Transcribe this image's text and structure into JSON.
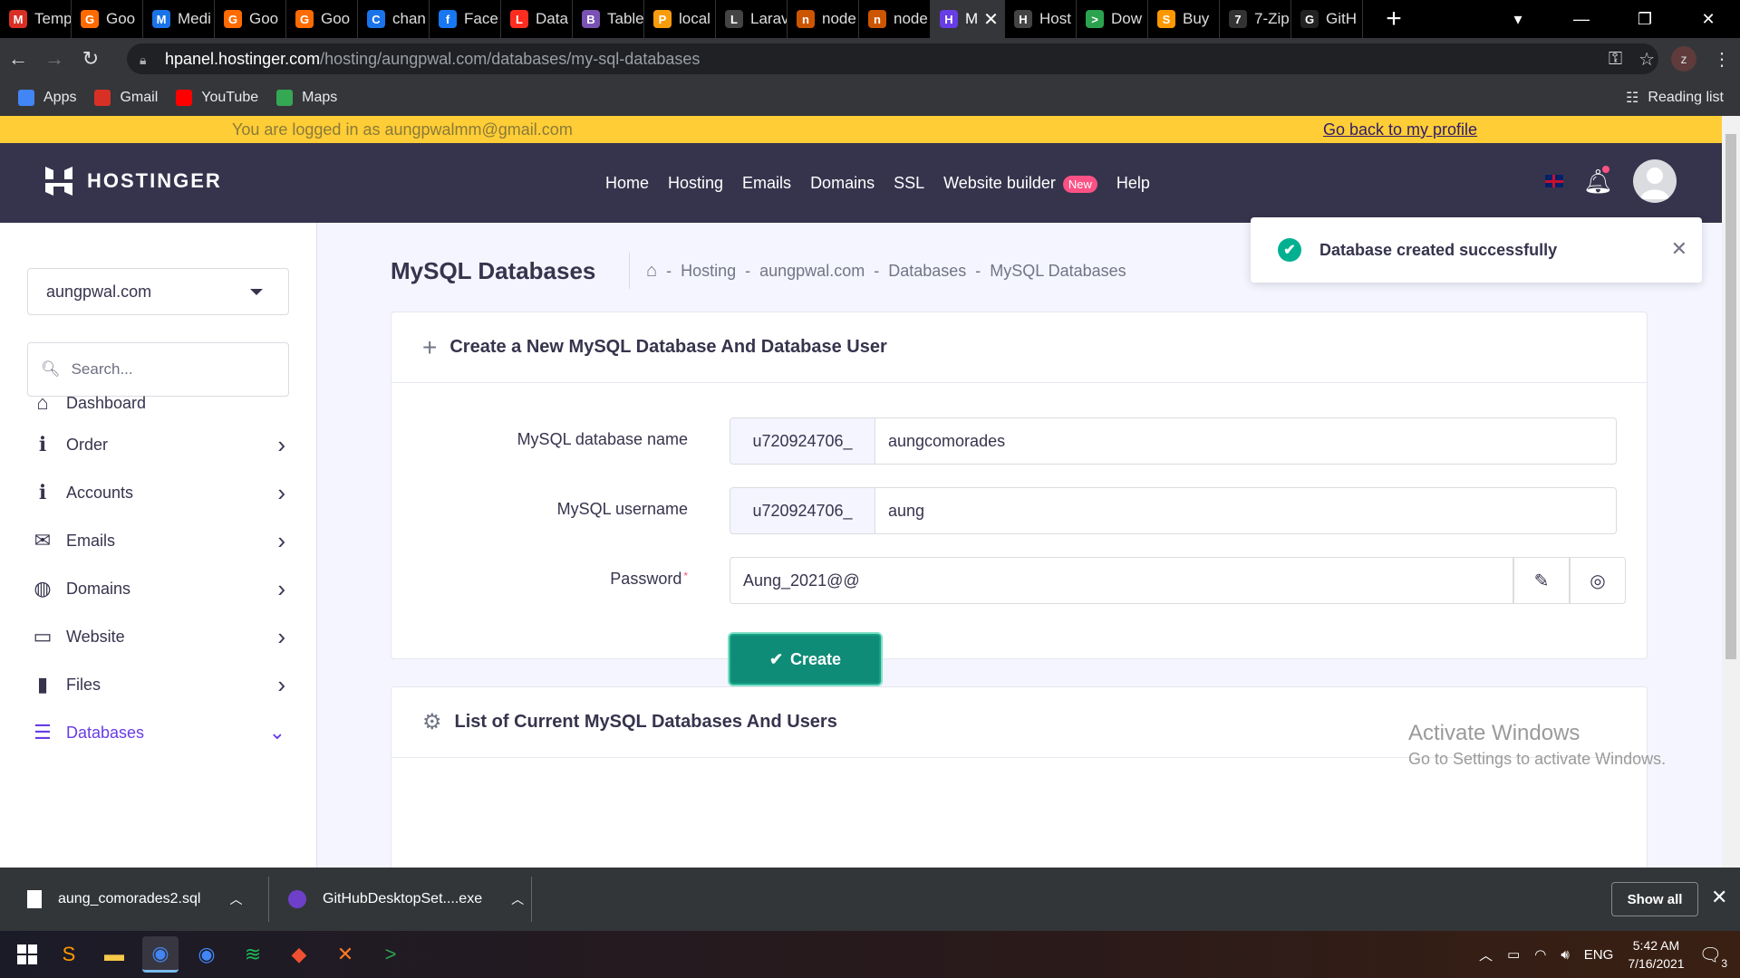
{
  "browser": {
    "tabs": [
      {
        "label": "Temp",
        "icon": "gmail-icon",
        "color": "#d93025",
        "glyph": "M"
      },
      {
        "label": "Goo",
        "icon": "chrome-ext-icon",
        "color": "#ff6b00",
        "glyph": "G"
      },
      {
        "label": "Medi",
        "icon": "media-icon",
        "color": "#1a73e8",
        "glyph": "M"
      },
      {
        "label": "Goo",
        "icon": "chrome-ext-icon",
        "color": "#ff6b00",
        "glyph": "G"
      },
      {
        "label": "Goo",
        "icon": "chrome-ext-icon",
        "color": "#ff6b00",
        "glyph": "G"
      },
      {
        "label": "chan",
        "icon": "loading-icon",
        "color": "#1a73e8",
        "glyph": "C"
      },
      {
        "label": "Face",
        "icon": "facebook-icon",
        "color": "#1877f2",
        "glyph": "f"
      },
      {
        "label": "Data",
        "icon": "laravel-icon",
        "color": "#ff2d20",
        "glyph": "L"
      },
      {
        "label": "Table",
        "icon": "bootstrap-icon",
        "color": "#7952b3",
        "glyph": "B"
      },
      {
        "label": "local",
        "icon": "phpmyadmin-icon",
        "color": "#f89c0e",
        "glyph": "P"
      },
      {
        "label": "Larav",
        "icon": "globe-icon",
        "color": "#444",
        "glyph": "L"
      },
      {
        "label": "node",
        "icon": "node-icon",
        "color": "#cc5500",
        "glyph": "n"
      },
      {
        "label": "node",
        "icon": "node-icon",
        "color": "#cc5500",
        "glyph": "n"
      },
      {
        "label": "M",
        "icon": "hostinger-icon",
        "color": "#673de6",
        "glyph": "H"
      },
      {
        "label": "Host",
        "icon": "globe-icon",
        "color": "#444",
        "glyph": "H"
      },
      {
        "label": "Dow",
        "icon": "terminal-icon",
        "color": "#2ba34e",
        "glyph": ">"
      },
      {
        "label": "Buy",
        "icon": "sublime-icon",
        "color": "#ff9800",
        "glyph": "S"
      },
      {
        "label": "7-Zip",
        "icon": "7zip-icon",
        "color": "#333",
        "glyph": "7"
      },
      {
        "label": "GitH",
        "icon": "github-icon",
        "color": "#222",
        "glyph": "G"
      }
    ],
    "active_tab_index": 13,
    "url_host": "hpanel.hostinger.com",
    "url_path": "/hosting/aungpwal.com/databases/my-sql-databases",
    "profile_initial": "z",
    "bookmarks": [
      {
        "label": "Apps",
        "icon": "apps-grid-icon",
        "color": "#4285f4"
      },
      {
        "label": "Gmail",
        "icon": "gmail-icon",
        "color": "#d93025"
      },
      {
        "label": "YouTube",
        "icon": "youtube-icon",
        "color": "#ff0000"
      },
      {
        "label": "Maps",
        "icon": "maps-icon",
        "color": "#34a853"
      }
    ],
    "reading_list": "Reading list"
  },
  "banner": {
    "logged_in_text": "You are logged in as aungpwalmm@gmail.com",
    "back_link": "Go back to my profile"
  },
  "header": {
    "brand": "HOSTINGER",
    "menu": [
      "Home",
      "Hosting",
      "Emails",
      "Domains",
      "SSL",
      "Website builder",
      "Help"
    ],
    "new_badge": "New"
  },
  "sidebar": {
    "domain": "aungpwal.com",
    "search_placeholder": "Search...",
    "items": [
      {
        "label": "Dashboard",
        "icon": "home-icon",
        "glyph": "⌂",
        "has_chevron": false
      },
      {
        "label": "Order",
        "icon": "info-icon",
        "glyph": "ℹ",
        "has_chevron": true
      },
      {
        "label": "Accounts",
        "icon": "info-icon",
        "glyph": "ℹ",
        "has_chevron": true
      },
      {
        "label": "Emails",
        "icon": "envelope-open-icon",
        "glyph": "✉",
        "has_chevron": true
      },
      {
        "label": "Domains",
        "icon": "globe-icon",
        "glyph": "◍",
        "has_chevron": true
      },
      {
        "label": "Website",
        "icon": "monitor-icon",
        "glyph": "▭",
        "has_chevron": true
      },
      {
        "label": "Files",
        "icon": "file-icon",
        "glyph": "▮",
        "has_chevron": true
      },
      {
        "label": "Databases",
        "icon": "database-icon",
        "glyph": "☰",
        "has_chevron": true,
        "active": true
      }
    ]
  },
  "main": {
    "title": "MySQL Databases",
    "breadcrumbs": [
      "Hosting",
      "aungpwal.com",
      "Databases",
      "MySQL Databases"
    ],
    "create_card": {
      "heading": "Create a New MySQL Database And Database User",
      "db_name_label": "MySQL database name",
      "db_prefix": "u720924706_",
      "db_name_value": "aungcomorades",
      "username_label": "MySQL username",
      "username_prefix": "u720924706_",
      "username_value": "aung",
      "password_label": "Password",
      "password_value": "Aung_2021@@",
      "create_button": "Create"
    },
    "list_card": {
      "heading": "List of Current MySQL Databases And Users"
    }
  },
  "toast": {
    "message": "Database created successfully"
  },
  "watermark": {
    "title": "Activate Windows",
    "subtitle": "Go to Settings to activate Windows."
  },
  "downloads": {
    "items": [
      "aung_comorades2.sql",
      "GitHubDesktopSet....exe"
    ],
    "show_all": "Show all"
  },
  "taskbar": {
    "apps": [
      {
        "icon": "sublime-icon",
        "color": "#ff9800",
        "glyph": "S"
      },
      {
        "icon": "file-explorer-icon",
        "color": "#f7c948",
        "glyph": "▬"
      },
      {
        "icon": "chrome-icon",
        "color": "#4285f4",
        "glyph": "◉",
        "active": true
      },
      {
        "icon": "chrome-icon",
        "color": "#4285f4",
        "glyph": "◉"
      },
      {
        "icon": "spotify-icon",
        "color": "#1db954",
        "glyph": "≋"
      },
      {
        "icon": "git-icon",
        "color": "#f05032",
        "glyph": "◆"
      },
      {
        "icon": "xampp-icon",
        "color": "#fb7a24",
        "glyph": "✕"
      },
      {
        "icon": "terminal-icon",
        "color": "#2ba34e",
        "glyph": ">"
      }
    ],
    "language": "ENG",
    "time": "5:42 AM",
    "date": "7/16/2021",
    "notifications": "3"
  }
}
